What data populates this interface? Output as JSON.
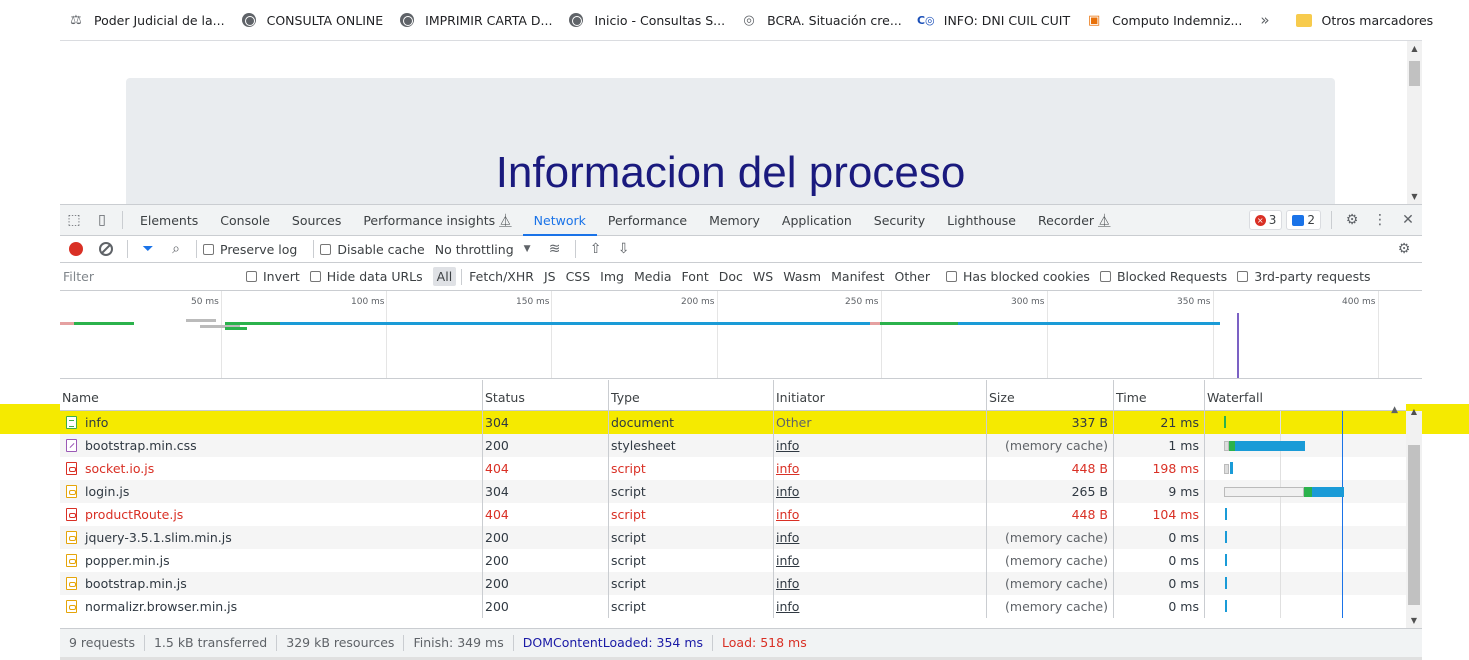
{
  "bookmarks": {
    "items": [
      {
        "label": "Poder Judicial de la...",
        "icon": "scales-icon"
      },
      {
        "label": "CONSULTA ONLINE",
        "icon": "globe-icon"
      },
      {
        "label": "IMPRIMIR CARTA D...",
        "icon": "globe-icon"
      },
      {
        "label": "Inicio - Consultas S...",
        "icon": "globe-icon"
      },
      {
        "label": "BCRA. Situación cre...",
        "icon": "bcra-icon"
      },
      {
        "label": "INFO: DNI CUIL CUIT",
        "icon": "cuit-icon"
      },
      {
        "label": "Computo Indemniz...",
        "icon": "calc-icon"
      }
    ],
    "more": "»",
    "other": "Otros marcadores"
  },
  "page": {
    "heading": "Informacion del proceso"
  },
  "devtools": {
    "tabs": [
      {
        "label": "Elements",
        "active": false
      },
      {
        "label": "Console",
        "active": false
      },
      {
        "label": "Sources",
        "active": false
      },
      {
        "label": "Performance insights ⏅",
        "active": false
      },
      {
        "label": "Network",
        "active": true
      },
      {
        "label": "Performance",
        "active": false
      },
      {
        "label": "Memory",
        "active": false
      },
      {
        "label": "Application",
        "active": false
      },
      {
        "label": "Security",
        "active": false
      },
      {
        "label": "Lighthouse",
        "active": false
      },
      {
        "label": "Recorder ⏅",
        "active": false
      }
    ],
    "error_count": "3",
    "message_count": "2"
  },
  "toolbar": {
    "preserve_log": "Preserve log",
    "disable_cache": "Disable cache",
    "throttling": "No throttling"
  },
  "filterbar": {
    "placeholder": "Filter",
    "invert": "Invert",
    "hide_data_urls": "Hide data URLs",
    "types": [
      "All",
      "Fetch/XHR",
      "JS",
      "CSS",
      "Img",
      "Media",
      "Font",
      "Doc",
      "WS",
      "Wasm",
      "Manifest",
      "Other"
    ],
    "active_type": "All",
    "has_blocked_cookies": "Has blocked cookies",
    "blocked_requests": "Blocked Requests",
    "third_party": "3rd-party requests"
  },
  "overview": {
    "ticks": [
      "50 ms",
      "100 ms",
      "150 ms",
      "200 ms",
      "250 ms",
      "300 ms",
      "350 ms",
      "400 ms"
    ]
  },
  "table": {
    "columns": [
      "Name",
      "Status",
      "Type",
      "Initiator",
      "Size",
      "Time",
      "Waterfall"
    ],
    "rows": [
      {
        "name": "info",
        "status": "304",
        "type": "document",
        "initiator": "Other",
        "size": "337 B",
        "time": "21 ms",
        "kind": "doc",
        "error": false,
        "highlighted": true
      },
      {
        "name": "bootstrap.min.css",
        "status": "200",
        "type": "stylesheet",
        "initiator": "info",
        "size": "(memory cache)",
        "time": "1 ms",
        "kind": "css",
        "error": false,
        "highlighted": false
      },
      {
        "name": "socket.io.js",
        "status": "404",
        "type": "script",
        "initiator": "info",
        "size": "448 B",
        "time": "198 ms",
        "kind": "js",
        "error": true,
        "highlighted": false
      },
      {
        "name": "login.js",
        "status": "304",
        "type": "script",
        "initiator": "info",
        "size": "265 B",
        "time": "9 ms",
        "kind": "js",
        "error": false,
        "highlighted": false
      },
      {
        "name": "productRoute.js",
        "status": "404",
        "type": "script",
        "initiator": "info",
        "size": "448 B",
        "time": "104 ms",
        "kind": "js",
        "error": true,
        "highlighted": false
      },
      {
        "name": "jquery-3.5.1.slim.min.js",
        "status": "200",
        "type": "script",
        "initiator": "info",
        "size": "(memory cache)",
        "time": "0 ms",
        "kind": "js",
        "error": false,
        "highlighted": false
      },
      {
        "name": "popper.min.js",
        "status": "200",
        "type": "script",
        "initiator": "info",
        "size": "(memory cache)",
        "time": "0 ms",
        "kind": "js",
        "error": false,
        "highlighted": false
      },
      {
        "name": "bootstrap.min.js",
        "status": "200",
        "type": "script",
        "initiator": "info",
        "size": "(memory cache)",
        "time": "0 ms",
        "kind": "js",
        "error": false,
        "highlighted": false
      },
      {
        "name": "normalizr.browser.min.js",
        "status": "200",
        "type": "script",
        "initiator": "info",
        "size": "(memory cache)",
        "time": "0 ms",
        "kind": "js",
        "error": false,
        "highlighted": false
      }
    ]
  },
  "summary": {
    "requests": "9 requests",
    "transferred": "1.5 kB transferred",
    "resources": "329 kB resources",
    "finish": "Finish: 349 ms",
    "dom_content_loaded": "DOMContentLoaded: 354 ms",
    "load": "Load: 518 ms"
  },
  "colors": {
    "highlight": "#f5ea00",
    "accent": "#1a73e8",
    "error": "#d93025",
    "heading": "#1a1a7e"
  }
}
